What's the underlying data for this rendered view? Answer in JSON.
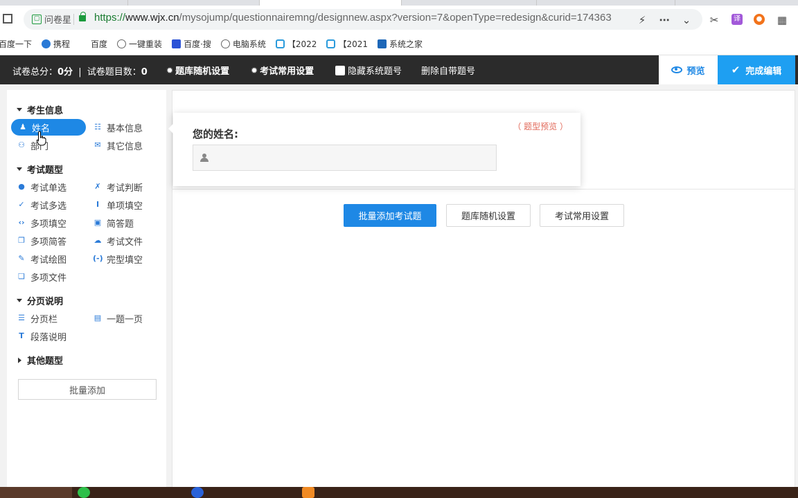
{
  "browser": {
    "site_tag": "问卷星",
    "url_scheme": "https://",
    "url_host": "www.wjx.cn",
    "url_path": "/mysojump/questionnairemng/designnew.aspx?version=7&openType=redesign&curid=174363",
    "icons": [
      "home-icon",
      "lock-icon",
      "lightning-icon",
      "more-icon",
      "chevron-down-icon",
      "scissors-icon",
      "translate-icon",
      "game-icon",
      "apps-icon"
    ],
    "colors": {
      "secure": "#1b9a3c",
      "translate_ext": "#a259d9",
      "game_ext": "#f2731b"
    }
  },
  "bookmarks": [
    {
      "label": "百度一下",
      "icon": "none"
    },
    {
      "label": "携程",
      "icon": "ctrip-icon"
    },
    {
      "label": "百度",
      "icon": "none"
    },
    {
      "label": "一键重装",
      "icon": "globe-icon"
    },
    {
      "label": "百度·搜",
      "icon": "baidu-paw-icon"
    },
    {
      "label": "电脑系统",
      "icon": "globe-icon"
    },
    {
      "label": "【2022",
      "icon": "bilibili-icon"
    },
    {
      "label": "【2021",
      "icon": "bilibili-icon"
    },
    {
      "label": "系统之家",
      "icon": "site-icon"
    }
  ],
  "toolbar": {
    "score_label": "试卷总分：",
    "score_value": "0分",
    "divider": "|",
    "count_label": "试卷题目数：",
    "count_value": "0",
    "random_bank": "题库随机设置",
    "exam_settings": "考试常用设置",
    "hide_numbers": "隐藏系统题号",
    "delete_numbers": "删除自带题号",
    "preview": "预览",
    "finish": "完成编辑",
    "colors": {
      "bar": "#2b2b2b",
      "finish": "#1e9ff2",
      "preview_text": "#1e88e5"
    }
  },
  "sidebar": {
    "sections": [
      {
        "title": "考生信息",
        "items": [
          {
            "label": "姓名",
            "icon": "person-icon",
            "active": true
          },
          {
            "label": "基本信息",
            "icon": "contact-card-icon"
          },
          {
            "label": "部门",
            "icon": "group-icon"
          },
          {
            "label": "其它信息",
            "icon": "mail-icon"
          }
        ]
      },
      {
        "title": "考试题型",
        "items": [
          {
            "label": "考试单选",
            "icon": "radio-dot-icon"
          },
          {
            "label": "考试判断",
            "icon": "check-cross-icon"
          },
          {
            "label": "考试多选",
            "icon": "check-icon"
          },
          {
            "label": "单项填空",
            "icon": "text-cursor-icon"
          },
          {
            "label": "多项填空",
            "icon": "brackets-icon"
          },
          {
            "label": "简答题",
            "icon": "text-box-icon"
          },
          {
            "label": "多项简答",
            "icon": "multi-text-icon"
          },
          {
            "label": "考试文件",
            "icon": "cloud-upload-icon"
          },
          {
            "label": "考试绘图",
            "icon": "pen-icon"
          },
          {
            "label": "完型填空",
            "icon": "cloze-icon"
          },
          {
            "label": "多项文件",
            "icon": "multi-file-icon"
          }
        ]
      },
      {
        "title": "分页说明",
        "items": [
          {
            "label": "分页栏",
            "icon": "page-break-icon"
          },
          {
            "label": "一题一页",
            "icon": "one-per-page-icon"
          },
          {
            "label": "段落说明",
            "icon": "paragraph-icon"
          }
        ]
      },
      {
        "title": "其他题型",
        "items": []
      }
    ],
    "batch_add": "批量添加",
    "accent": "#1e88e5"
  },
  "preview_popup": {
    "tag": "（ 题型预览 ）",
    "question": "您的姓名:",
    "input_icon": "user-icon"
  },
  "main": {
    "batch_add_exam": "批量添加考试题",
    "random_bank": "题库随机设置",
    "exam_settings": "考试常用设置"
  }
}
